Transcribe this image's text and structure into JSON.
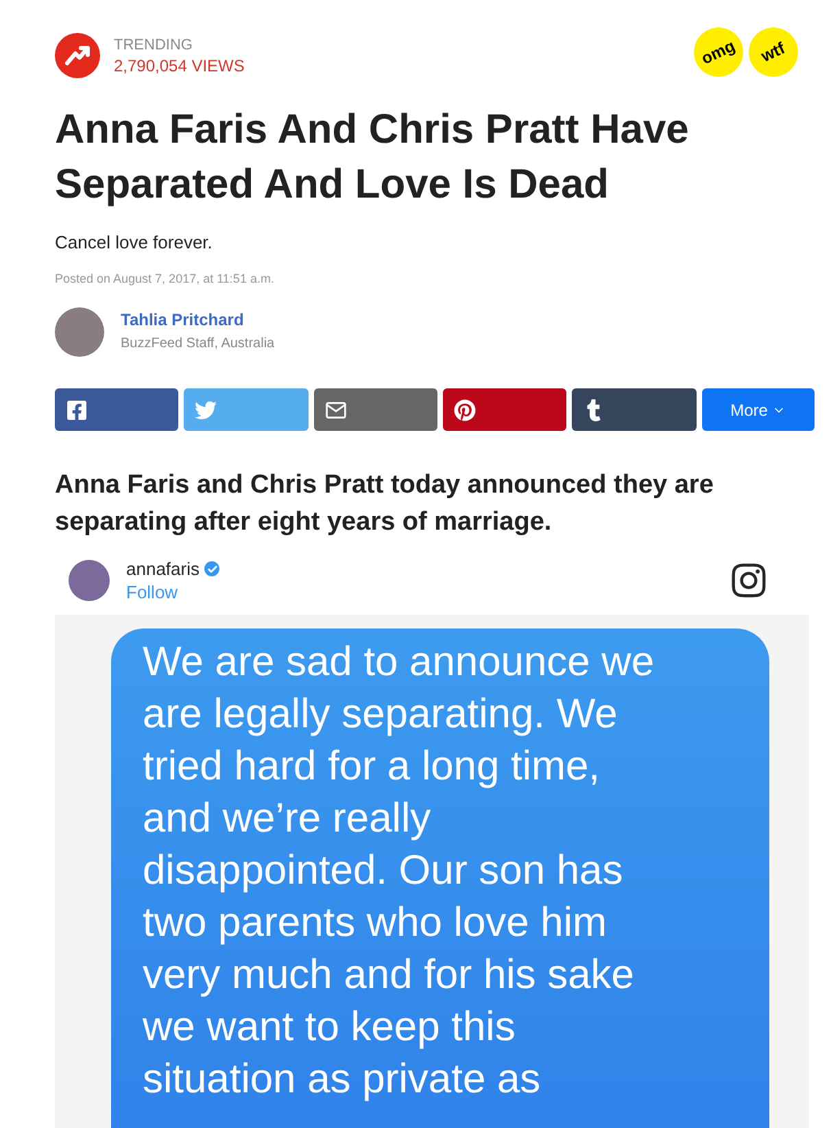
{
  "trending": {
    "label": "TRENDING",
    "views": "2,790,054 VIEWS"
  },
  "badges": [
    {
      "label": "omg"
    },
    {
      "label": "wtf"
    }
  ],
  "title": "Anna Faris And Chris Pratt Have Separated And Love Is Dead",
  "subtitle": "Cancel love forever.",
  "posted": "Posted on August 7, 2017, at 11:51 a.m.",
  "author": {
    "name": "Tahlia Pritchard",
    "role": "BuzzFeed Staff, Australia"
  },
  "share_buttons": [
    {
      "kind": "facebook"
    },
    {
      "kind": "twitter"
    },
    {
      "kind": "email"
    },
    {
      "kind": "pinterest"
    },
    {
      "kind": "tumblr"
    },
    {
      "kind": "more",
      "label": "More"
    }
  ],
  "lead": "Anna Faris and Chris Pratt today announced they are separating after eight years of marriage.",
  "embed": {
    "username": "annafaris",
    "verified": true,
    "follow": "Follow",
    "message_lines": [
      "We are sad to announce we",
      "are legally separating. We",
      "tried hard for a long time,",
      "and we’re really",
      "disappointed.  Our son has",
      "two parents who love him",
      "very much and for his sake",
      "we want to keep this",
      "situation as private as"
    ]
  }
}
